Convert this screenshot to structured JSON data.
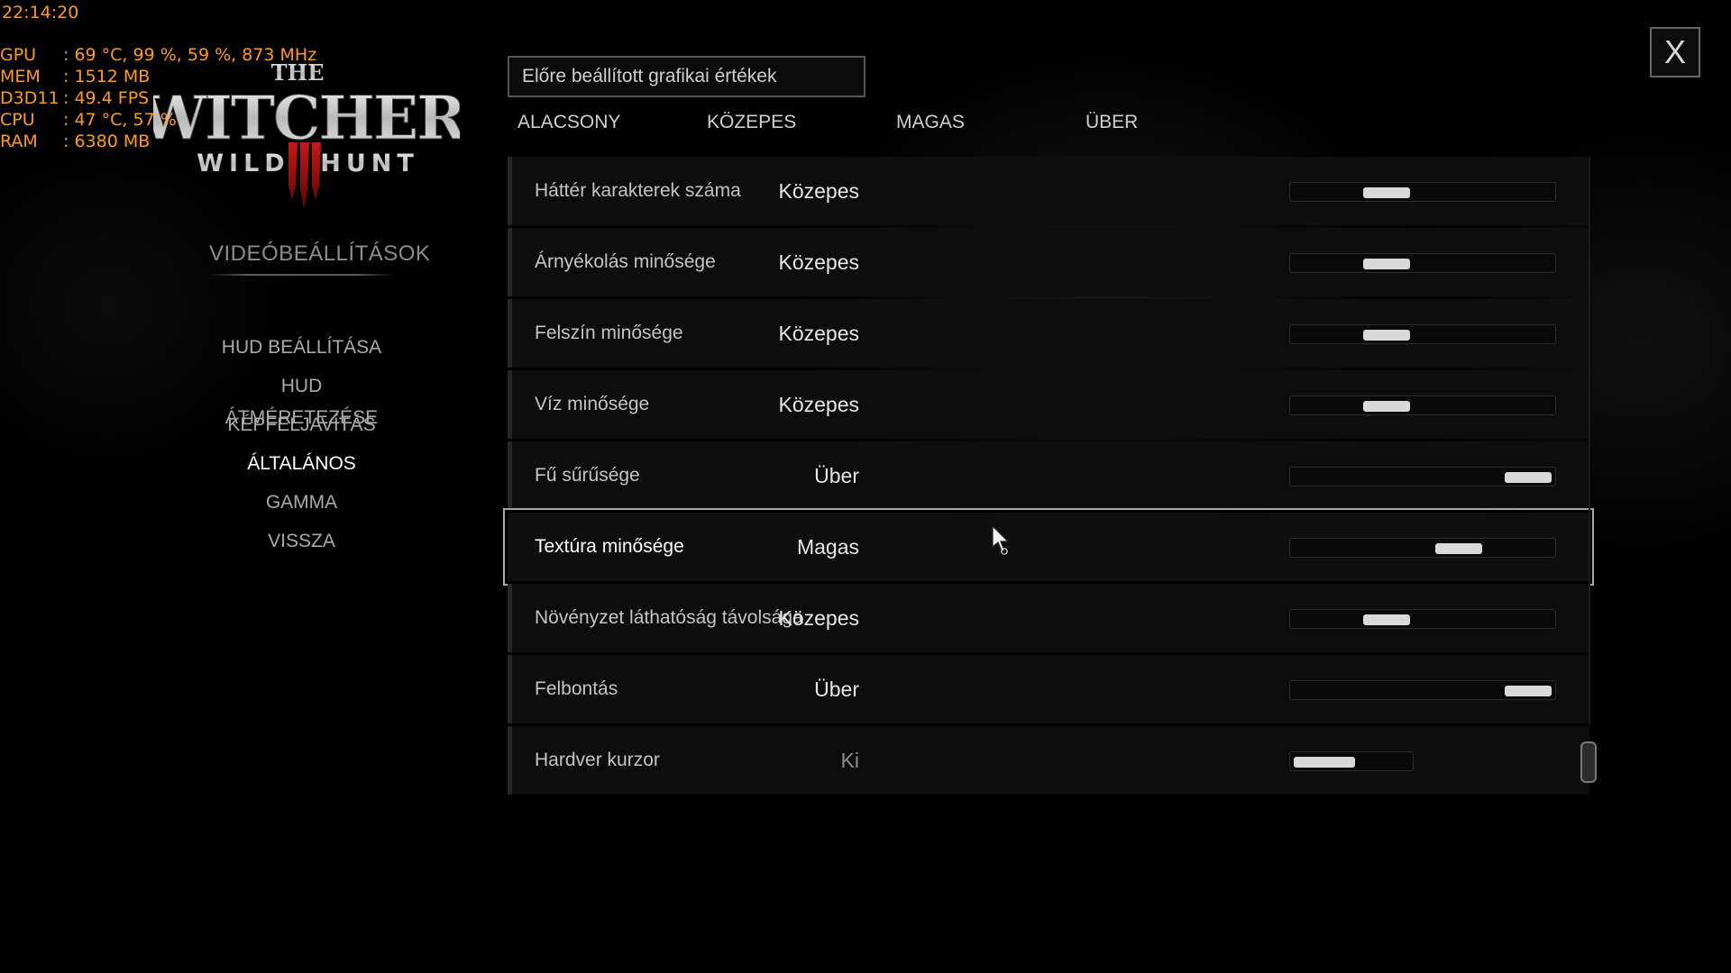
{
  "osd": {
    "clock": "22:14:20",
    "rows": [
      {
        "key": "GPU",
        "value": "69 °C, 99 %, 59 %, 873 MHz"
      },
      {
        "key": "MEM",
        "value": "1512 MB"
      },
      {
        "key": "D3D11",
        "value": "49.4 FPS"
      },
      {
        "key": "CPU",
        "value": "47 °C, 57 %"
      },
      {
        "key": "RAM",
        "value": "6380 MB"
      }
    ]
  },
  "logo": {
    "the": "THE",
    "witcher": "WITCHER",
    "wild": "WILD",
    "hunt": "HUNT"
  },
  "menu": {
    "title": "VIDEÓBEÁLLÍTÁSOK",
    "items": [
      {
        "label": "HUD BEÁLLÍTÁSA"
      },
      {
        "label": "HUD ÁTMÉRETEZÉSE"
      },
      {
        "label": "KÉPFELJAVÍTÁS"
      },
      {
        "label": "ÁLTALÁNOS"
      },
      {
        "label": "GAMMA"
      },
      {
        "label": "VISSZA"
      }
    ],
    "active_index": 3
  },
  "presets": {
    "box_label": "Előre beállított grafikai értékek",
    "tabs": [
      "ALACSONY",
      "KÖZEPES",
      "MAGAS",
      "ÜBER"
    ]
  },
  "settings": [
    {
      "label": "Háttér karakterek száma",
      "value": "Közepes",
      "level": 0.33
    },
    {
      "label": "Árnyékolás minősége",
      "value": "Közepes",
      "level": 0.33
    },
    {
      "label": "Felszín minősége",
      "value": "Közepes",
      "level": 0.33
    },
    {
      "label": "Víz minősége",
      "value": "Közepes",
      "level": 0.33
    },
    {
      "label": "Fű sűrűsége",
      "value": "Über",
      "level": 1.0
    },
    {
      "label": "Textúra minősége",
      "value": "Magas",
      "level": 0.67
    },
    {
      "label": "Növényzet láthatóság távolsága",
      "value": "Közepes",
      "level": 0.33
    },
    {
      "label": "Felbontás",
      "value": "Über",
      "level": 1.0
    },
    {
      "label": "Hardver kurzor",
      "value": "Ki",
      "level": 0.0,
      "kind": "toggle"
    }
  ],
  "selected_index": 5,
  "close": {
    "label": "X"
  },
  "colors": {
    "osd": "#ff9a1e",
    "background": "#000000",
    "text": "#d8d8d8"
  }
}
